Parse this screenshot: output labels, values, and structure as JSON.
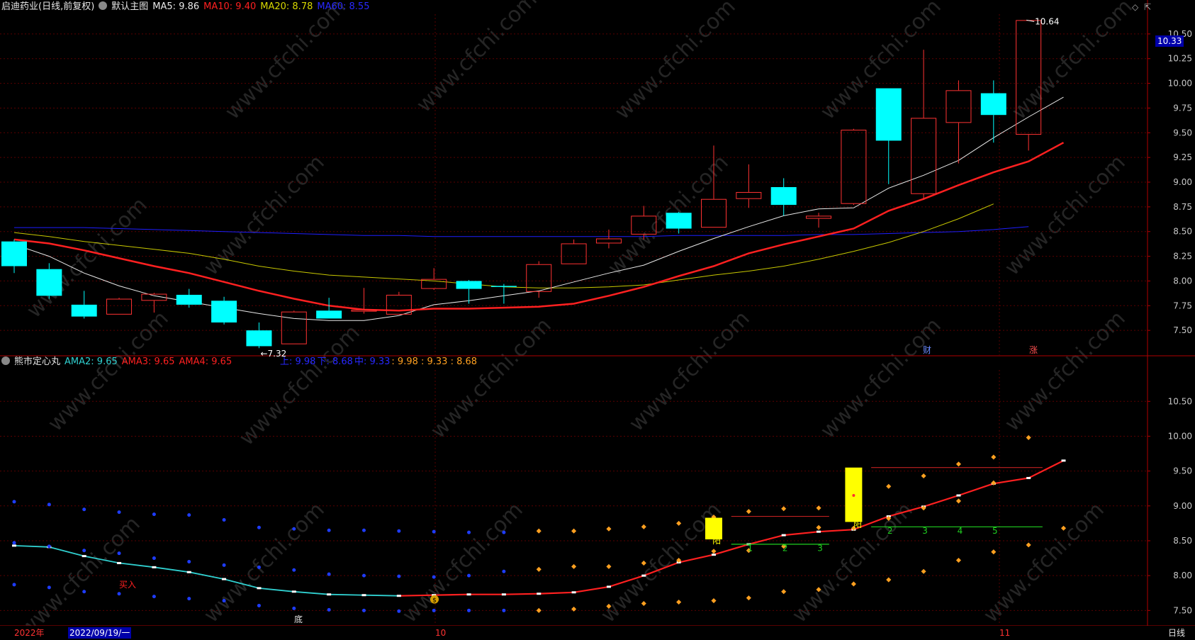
{
  "colors": {
    "bg": "#000000",
    "grid": "#5a0000",
    "border": "#b00000",
    "axis_text": "#c8c8c8",
    "up": "#ff3232",
    "down": "#00ffff",
    "ma5": "#e8e8e8",
    "ma10": "#ff2020",
    "ma20": "#c8c800",
    "ma60": "#1e1eff",
    "ama_cyan": "#30d0d0",
    "ama_red": "#ff2020",
    "dot_blue": "#1e3cff",
    "dot_orange": "#ffa020",
    "white_marker": "#ffffff",
    "green": "#20d020",
    "yellow": "#ffff00",
    "watermark": "#252525"
  },
  "main_header": {
    "stock": "启迪药业(日线,前复权)",
    "template": "默认主图",
    "ma5": "MA5: 9.86",
    "ma10": "MA10: 9.40",
    "ma20": "MA20: 8.78",
    "ma60": "MA60: 8.55"
  },
  "sub_header": {
    "name": "熊市定心丸",
    "ama2": "AMA2: 9.65",
    "ama3": "AMA3: 9.65",
    "ama4": "AMA4: 9.65",
    "up": "上: 9.98",
    "down": "下: 8.68",
    "mid": "中: 9.33",
    "vals": ": 9.98 : 9.33 : 8.68"
  },
  "current_price": "10.33",
  "watermark": "www.cfchi.com",
  "timebar": {
    "year": "2022年",
    "cursor_date": "2022/09/19/一",
    "month_oct": "10",
    "month_nov": "11",
    "period": "日线"
  },
  "chart_data": [
    {
      "type": "candlestick",
      "title": "启迪药业(日线,前复权)",
      "ylim": [
        7.25,
        10.7
      ],
      "yticks": [
        7.5,
        7.75,
        8.0,
        8.25,
        8.5,
        8.75,
        9.0,
        9.25,
        9.5,
        9.75,
        10.0,
        10.25,
        10.5
      ],
      "candles": [
        {
          "o": 8.15,
          "h": 8.42,
          "l": 8.08,
          "c": 8.4,
          "dir": "down"
        },
        {
          "o": 8.12,
          "h": 8.18,
          "l": 7.82,
          "c": 7.85,
          "dir": "down"
        },
        {
          "o": 7.76,
          "h": 7.9,
          "l": 7.62,
          "c": 7.64,
          "dir": "down"
        },
        {
          "o": 7.66,
          "h": 7.83,
          "l": 7.66,
          "c": 7.82,
          "dir": "up"
        },
        {
          "o": 7.8,
          "h": 7.88,
          "l": 7.68,
          "c": 7.87,
          "dir": "up"
        },
        {
          "o": 7.86,
          "h": 7.92,
          "l": 7.73,
          "c": 7.76,
          "dir": "down"
        },
        {
          "o": 7.8,
          "h": 7.84,
          "l": 7.56,
          "c": 7.58,
          "dir": "down"
        },
        {
          "o": 7.5,
          "h": 7.58,
          "l": 7.32,
          "c": 7.34,
          "dir": "down"
        },
        {
          "o": 7.36,
          "h": 7.7,
          "l": 7.36,
          "c": 7.69,
          "dir": "up"
        },
        {
          "o": 7.7,
          "h": 7.83,
          "l": 7.62,
          "c": 7.62,
          "dir": "down"
        },
        {
          "o": 7.69,
          "h": 7.93,
          "l": 7.67,
          "c": 7.71,
          "dir": "up"
        },
        {
          "o": 7.66,
          "h": 7.89,
          "l": 7.66,
          "c": 7.86,
          "dir": "up"
        },
        {
          "o": 7.92,
          "h": 8.13,
          "l": 7.91,
          "c": 8.02,
          "dir": "up"
        },
        {
          "o": 8.0,
          "h": 8.01,
          "l": 7.77,
          "c": 7.92,
          "dir": "down"
        },
        {
          "o": 7.95,
          "h": 7.97,
          "l": 7.77,
          "c": 7.95,
          "dir": "down"
        },
        {
          "o": 7.89,
          "h": 8.2,
          "l": 7.83,
          "c": 8.17,
          "dir": "up"
        },
        {
          "o": 8.17,
          "h": 8.42,
          "l": 8.17,
          "c": 8.38,
          "dir": "up"
        },
        {
          "o": 8.38,
          "h": 8.52,
          "l": 8.33,
          "c": 8.43,
          "dir": "up"
        },
        {
          "o": 8.47,
          "h": 8.76,
          "l": 8.42,
          "c": 8.66,
          "dir": "up"
        },
        {
          "o": 8.69,
          "h": 8.7,
          "l": 8.48,
          "c": 8.53,
          "dir": "down"
        },
        {
          "o": 8.54,
          "h": 9.37,
          "l": 8.54,
          "c": 8.83,
          "dir": "up"
        },
        {
          "o": 8.83,
          "h": 9.18,
          "l": 8.74,
          "c": 8.9,
          "dir": "up"
        },
        {
          "o": 8.95,
          "h": 9.04,
          "l": 8.66,
          "c": 8.77,
          "dir": "down"
        },
        {
          "o": 8.63,
          "h": 8.69,
          "l": 8.54,
          "c": 8.66,
          "dir": "up"
        },
        {
          "o": 8.78,
          "h": 9.54,
          "l": 8.77,
          "c": 9.53,
          "dir": "up"
        },
        {
          "o": 9.95,
          "h": 9.95,
          "l": 8.98,
          "c": 9.42,
          "dir": "down"
        },
        {
          "o": 8.88,
          "h": 10.34,
          "l": 8.82,
          "c": 9.65,
          "dir": "up"
        },
        {
          "o": 9.6,
          "h": 10.03,
          "l": 9.19,
          "c": 9.93,
          "dir": "up"
        },
        {
          "o": 9.9,
          "h": 10.03,
          "l": 9.4,
          "c": 9.68,
          "dir": "down"
        },
        {
          "o": 9.48,
          "h": 10.64,
          "l": 9.32,
          "c": 10.64,
          "dir": "up"
        }
      ],
      "series": [
        {
          "name": "MA5",
          "values": [
            8.37,
            8.25,
            8.08,
            7.95,
            7.85,
            7.79,
            7.73,
            7.67,
            7.62,
            7.6,
            7.6,
            7.65,
            7.76,
            7.8,
            7.85,
            7.9,
            7.99,
            8.08,
            8.16,
            8.3,
            8.43,
            8.55,
            8.66,
            8.73,
            8.74,
            8.94,
            9.07,
            9.22,
            9.45,
            9.66,
            9.86
          ]
        },
        {
          "name": "MA10",
          "values": [
            8.42,
            8.38,
            8.31,
            8.23,
            8.15,
            8.08,
            7.99,
            7.9,
            7.82,
            7.75,
            7.71,
            7.7,
            7.72,
            7.72,
            7.73,
            7.74,
            7.77,
            7.85,
            7.94,
            8.05,
            8.15,
            8.28,
            8.37,
            8.45,
            8.53,
            8.71,
            8.83,
            8.97,
            9.1,
            9.21,
            9.4
          ]
        },
        {
          "name": "MA20",
          "values": [
            8.49,
            8.45,
            8.4,
            8.36,
            8.32,
            8.28,
            8.22,
            8.15,
            8.1,
            8.06,
            8.04,
            8.02,
            8.0,
            7.97,
            7.94,
            7.93,
            7.93,
            7.94,
            7.96,
            8.01,
            8.06,
            8.1,
            8.15,
            8.22,
            8.3,
            8.39,
            8.5,
            8.63,
            8.78
          ]
        },
        {
          "name": "MA60",
          "values": [
            8.54,
            8.54,
            8.54,
            8.53,
            8.52,
            8.51,
            8.5,
            8.49,
            8.48,
            8.47,
            8.46,
            8.46,
            8.45,
            8.45,
            8.45,
            8.45,
            8.45,
            8.45,
            8.45,
            8.46,
            8.46,
            8.46,
            8.46,
            8.47,
            8.47,
            8.48,
            8.49,
            8.5,
            8.52,
            8.55
          ]
        }
      ],
      "annotations": [
        {
          "text": "10.64",
          "label": "high"
        },
        {
          "text": "←7.32",
          "label": "low"
        },
        {
          "text": "财"
        },
        {
          "text": "涨"
        }
      ]
    },
    {
      "type": "line",
      "title": "熊市定心丸",
      "ylim": [
        7.3,
        10.95
      ],
      "yticks": [
        7.5,
        8.0,
        8.5,
        9.0,
        9.5,
        10.0,
        10.5
      ],
      "series": [
        {
          "name": "AMA2",
          "values": [
            8.43,
            8.41,
            8.28,
            8.18,
            8.12,
            8.05,
            7.95,
            7.82,
            7.77,
            7.73,
            7.72,
            7.71,
            7.72,
            7.73,
            7.73,
            7.74,
            7.76,
            7.84,
            8.0,
            8.19,
            8.3,
            8.45,
            8.58,
            8.63,
            8.66,
            8.85,
            8.99,
            9.15,
            9.32,
            9.4,
            9.65
          ]
        },
        {
          "name": "上轨点",
          "values": [
            9.06,
            9.02,
            8.95,
            8.91,
            8.88,
            8.87,
            8.8,
            8.69,
            8.67,
            8.65,
            8.65,
            8.64,
            8.63,
            8.62,
            8.62,
            8.64,
            8.64,
            8.67,
            8.7,
            8.75,
            8.84,
            8.92,
            8.96,
            8.97,
            9.2,
            9.28,
            9.43,
            9.6,
            9.7,
            9.98
          ]
        },
        {
          "name": "中轨点",
          "values": [
            8.47,
            8.42,
            8.36,
            8.32,
            8.25,
            8.2,
            8.15,
            8.12,
            8.08,
            8.02,
            8.0,
            7.99,
            7.98,
            8.0,
            8.06,
            8.09,
            8.13,
            8.13,
            8.18,
            8.22,
            8.35,
            8.36,
            8.42,
            8.69,
            8.68,
            8.82,
            8.97,
            9.07,
            9.33
          ]
        },
        {
          "name": "下轨点",
          "values": [
            7.87,
            7.83,
            7.77,
            7.74,
            7.7,
            7.67,
            7.64,
            7.57,
            7.53,
            7.51,
            7.5,
            7.49,
            7.5,
            7.5,
            7.5,
            7.5,
            7.52,
            7.56,
            7.6,
            7.62,
            7.64,
            7.68,
            7.77,
            7.8,
            7.88,
            7.94,
            8.06,
            8.22,
            8.34,
            8.44,
            8.68
          ]
        }
      ],
      "levels": [
        {
          "label": "upper1",
          "value": 8.85
        },
        {
          "label": "lower1",
          "value": 8.45
        },
        {
          "label": "upper2",
          "value": 9.55
        },
        {
          "label": "lower2",
          "value": 8.7
        }
      ],
      "annotations": [
        {
          "text": "买入"
        },
        {
          "text": "底"
        },
        {
          "text": "阳"
        },
        {
          "text": "1"
        },
        {
          "text": "2"
        },
        {
          "text": "3"
        },
        {
          "text": "阳"
        },
        {
          "text": "1"
        },
        {
          "text": "2"
        },
        {
          "text": "3"
        },
        {
          "text": "4"
        },
        {
          "text": "5"
        }
      ]
    }
  ]
}
